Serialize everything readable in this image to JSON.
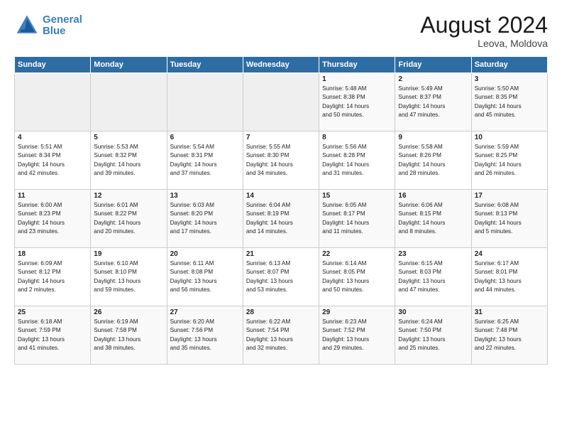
{
  "header": {
    "logo_general": "General",
    "logo_blue": "Blue",
    "month": "August 2024",
    "location": "Leova, Moldova"
  },
  "weekdays": [
    "Sunday",
    "Monday",
    "Tuesday",
    "Wednesday",
    "Thursday",
    "Friday",
    "Saturday"
  ],
  "weeks": [
    [
      {
        "day": "",
        "info": ""
      },
      {
        "day": "",
        "info": ""
      },
      {
        "day": "",
        "info": ""
      },
      {
        "day": "",
        "info": ""
      },
      {
        "day": "1",
        "info": "Sunrise: 5:48 AM\nSunset: 8:38 PM\nDaylight: 14 hours\nand 50 minutes."
      },
      {
        "day": "2",
        "info": "Sunrise: 5:49 AM\nSunset: 8:37 PM\nDaylight: 14 hours\nand 47 minutes."
      },
      {
        "day": "3",
        "info": "Sunrise: 5:50 AM\nSunset: 8:35 PM\nDaylight: 14 hours\nand 45 minutes."
      }
    ],
    [
      {
        "day": "4",
        "info": "Sunrise: 5:51 AM\nSunset: 8:34 PM\nDaylight: 14 hours\nand 42 minutes."
      },
      {
        "day": "5",
        "info": "Sunrise: 5:53 AM\nSunset: 8:32 PM\nDaylight: 14 hours\nand 39 minutes."
      },
      {
        "day": "6",
        "info": "Sunrise: 5:54 AM\nSunset: 8:31 PM\nDaylight: 14 hours\nand 37 minutes."
      },
      {
        "day": "7",
        "info": "Sunrise: 5:55 AM\nSunset: 8:30 PM\nDaylight: 14 hours\nand 34 minutes."
      },
      {
        "day": "8",
        "info": "Sunrise: 5:56 AM\nSunset: 8:28 PM\nDaylight: 14 hours\nand 31 minutes."
      },
      {
        "day": "9",
        "info": "Sunrise: 5:58 AM\nSunset: 8:26 PM\nDaylight: 14 hours\nand 28 minutes."
      },
      {
        "day": "10",
        "info": "Sunrise: 5:59 AM\nSunset: 8:25 PM\nDaylight: 14 hours\nand 26 minutes."
      }
    ],
    [
      {
        "day": "11",
        "info": "Sunrise: 6:00 AM\nSunset: 8:23 PM\nDaylight: 14 hours\nand 23 minutes."
      },
      {
        "day": "12",
        "info": "Sunrise: 6:01 AM\nSunset: 8:22 PM\nDaylight: 14 hours\nand 20 minutes."
      },
      {
        "day": "13",
        "info": "Sunrise: 6:03 AM\nSunset: 8:20 PM\nDaylight: 14 hours\nand 17 minutes."
      },
      {
        "day": "14",
        "info": "Sunrise: 6:04 AM\nSunset: 8:19 PM\nDaylight: 14 hours\nand 14 minutes."
      },
      {
        "day": "15",
        "info": "Sunrise: 6:05 AM\nSunset: 8:17 PM\nDaylight: 14 hours\nand 11 minutes."
      },
      {
        "day": "16",
        "info": "Sunrise: 6:06 AM\nSunset: 8:15 PM\nDaylight: 14 hours\nand 8 minutes."
      },
      {
        "day": "17",
        "info": "Sunrise: 6:08 AM\nSunset: 8:13 PM\nDaylight: 14 hours\nand 5 minutes."
      }
    ],
    [
      {
        "day": "18",
        "info": "Sunrise: 6:09 AM\nSunset: 8:12 PM\nDaylight: 14 hours\nand 2 minutes."
      },
      {
        "day": "19",
        "info": "Sunrise: 6:10 AM\nSunset: 8:10 PM\nDaylight: 13 hours\nand 59 minutes."
      },
      {
        "day": "20",
        "info": "Sunrise: 6:11 AM\nSunset: 8:08 PM\nDaylight: 13 hours\nand 56 minutes."
      },
      {
        "day": "21",
        "info": "Sunrise: 6:13 AM\nSunset: 8:07 PM\nDaylight: 13 hours\nand 53 minutes."
      },
      {
        "day": "22",
        "info": "Sunrise: 6:14 AM\nSunset: 8:05 PM\nDaylight: 13 hours\nand 50 minutes."
      },
      {
        "day": "23",
        "info": "Sunrise: 6:15 AM\nSunset: 8:03 PM\nDaylight: 13 hours\nand 47 minutes."
      },
      {
        "day": "24",
        "info": "Sunrise: 6:17 AM\nSunset: 8:01 PM\nDaylight: 13 hours\nand 44 minutes."
      }
    ],
    [
      {
        "day": "25",
        "info": "Sunrise: 6:18 AM\nSunset: 7:59 PM\nDaylight: 13 hours\nand 41 minutes."
      },
      {
        "day": "26",
        "info": "Sunrise: 6:19 AM\nSunset: 7:58 PM\nDaylight: 13 hours\nand 38 minutes."
      },
      {
        "day": "27",
        "info": "Sunrise: 6:20 AM\nSunset: 7:56 PM\nDaylight: 13 hours\nand 35 minutes."
      },
      {
        "day": "28",
        "info": "Sunrise: 6:22 AM\nSunset: 7:54 PM\nDaylight: 13 hours\nand 32 minutes."
      },
      {
        "day": "29",
        "info": "Sunrise: 6:23 AM\nSunset: 7:52 PM\nDaylight: 13 hours\nand 29 minutes."
      },
      {
        "day": "30",
        "info": "Sunrise: 6:24 AM\nSunset: 7:50 PM\nDaylight: 13 hours\nand 25 minutes."
      },
      {
        "day": "31",
        "info": "Sunrise: 6:25 AM\nSunset: 7:48 PM\nDaylight: 13 hours\nand 22 minutes."
      }
    ]
  ]
}
